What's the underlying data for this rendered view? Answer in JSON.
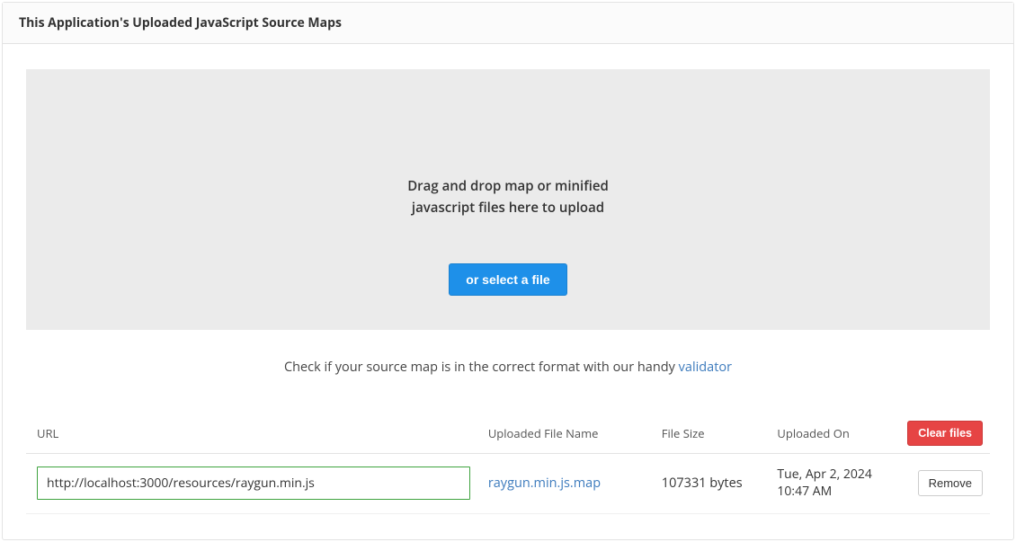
{
  "panel": {
    "title": "This Application's Uploaded JavaScript Source Maps"
  },
  "dropzone": {
    "line1": "Drag and drop map or minified",
    "line2": "javascript files here to upload",
    "select_button": "or select a file"
  },
  "validator_note": {
    "prefix": "Check if your source map is in the correct format with our handy ",
    "link_text": "validator"
  },
  "table": {
    "headers": {
      "url": "URL",
      "filename": "Uploaded File Name",
      "size": "File Size",
      "uploaded_on": "Uploaded On"
    },
    "clear_button": "Clear files",
    "rows": [
      {
        "url": "http://localhost:3000/resources/raygun.min.js",
        "filename": "raygun.min.js.map",
        "size": "107331 bytes",
        "uploaded_on": "Tue, Apr 2, 2024 10:47 AM",
        "remove_label": "Remove"
      }
    ]
  }
}
